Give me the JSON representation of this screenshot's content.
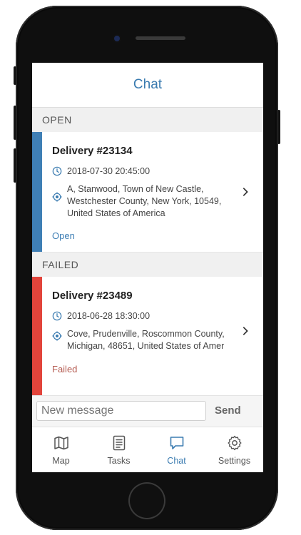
{
  "header": {
    "title": "Chat"
  },
  "sections": {
    "open": {
      "label": "OPEN"
    },
    "failed": {
      "label": "FAILED"
    }
  },
  "cards": [
    {
      "title": "Delivery #23134",
      "datetime": "2018-07-30 20:45:00",
      "address": "A, Stanwood, Town of New Castle,\nWestchester County, New York, 10549,\nUnited States of America",
      "status": "Open",
      "accent_color": "#3f7fb5",
      "status_color": "#3f7fb5"
    },
    {
      "title": "Delivery #23489",
      "datetime": "2018-06-28 18:30:00",
      "address": "Cove, Prudenville, Roscommon County,\nMichigan, 48651, United States of Amer",
      "status": "Failed",
      "accent_color": "#e2443b",
      "status_color": "#b55c52"
    }
  ],
  "composer": {
    "placeholder": "New message",
    "send_label": "Send"
  },
  "tabs": [
    {
      "label": "Map",
      "icon": "map-icon"
    },
    {
      "label": "Tasks",
      "icon": "tasks-icon"
    },
    {
      "label": "Chat",
      "icon": "chat-icon",
      "active": true
    },
    {
      "label": "Settings",
      "icon": "gear-icon"
    }
  ],
  "colors": {
    "brand": "#3a7bb0"
  }
}
